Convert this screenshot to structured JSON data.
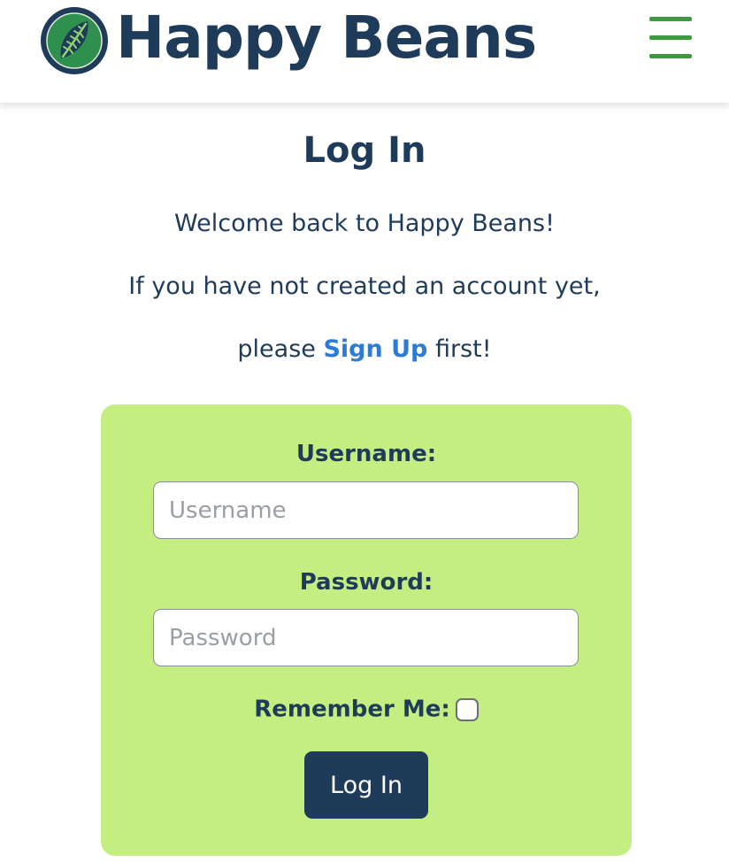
{
  "header": {
    "brand": "Happy Beans",
    "logo_icon": "coffee-bean-leaf-logo",
    "menu_icon": "hamburger-menu-icon",
    "colors": {
      "brand_navy": "#1f3b5a",
      "menu_green": "#3f9a3f"
    }
  },
  "main": {
    "title": "Log In",
    "intro_line1": "Welcome back to Happy Beans!",
    "intro_line2": "If you have not created an account yet,",
    "intro_line3_prefix": "please ",
    "signup_link": "Sign Up",
    "intro_line3_suffix": " first!",
    "link_color": "#2e7bd6"
  },
  "form": {
    "username_label": "Username:",
    "username_placeholder": "Username",
    "username_value": "",
    "password_label": "Password:",
    "password_placeholder": "Password",
    "password_value": "",
    "remember_label": "Remember Me:",
    "remember_checked": false,
    "submit_label": "Log In",
    "card_color": "#c5ee82"
  }
}
